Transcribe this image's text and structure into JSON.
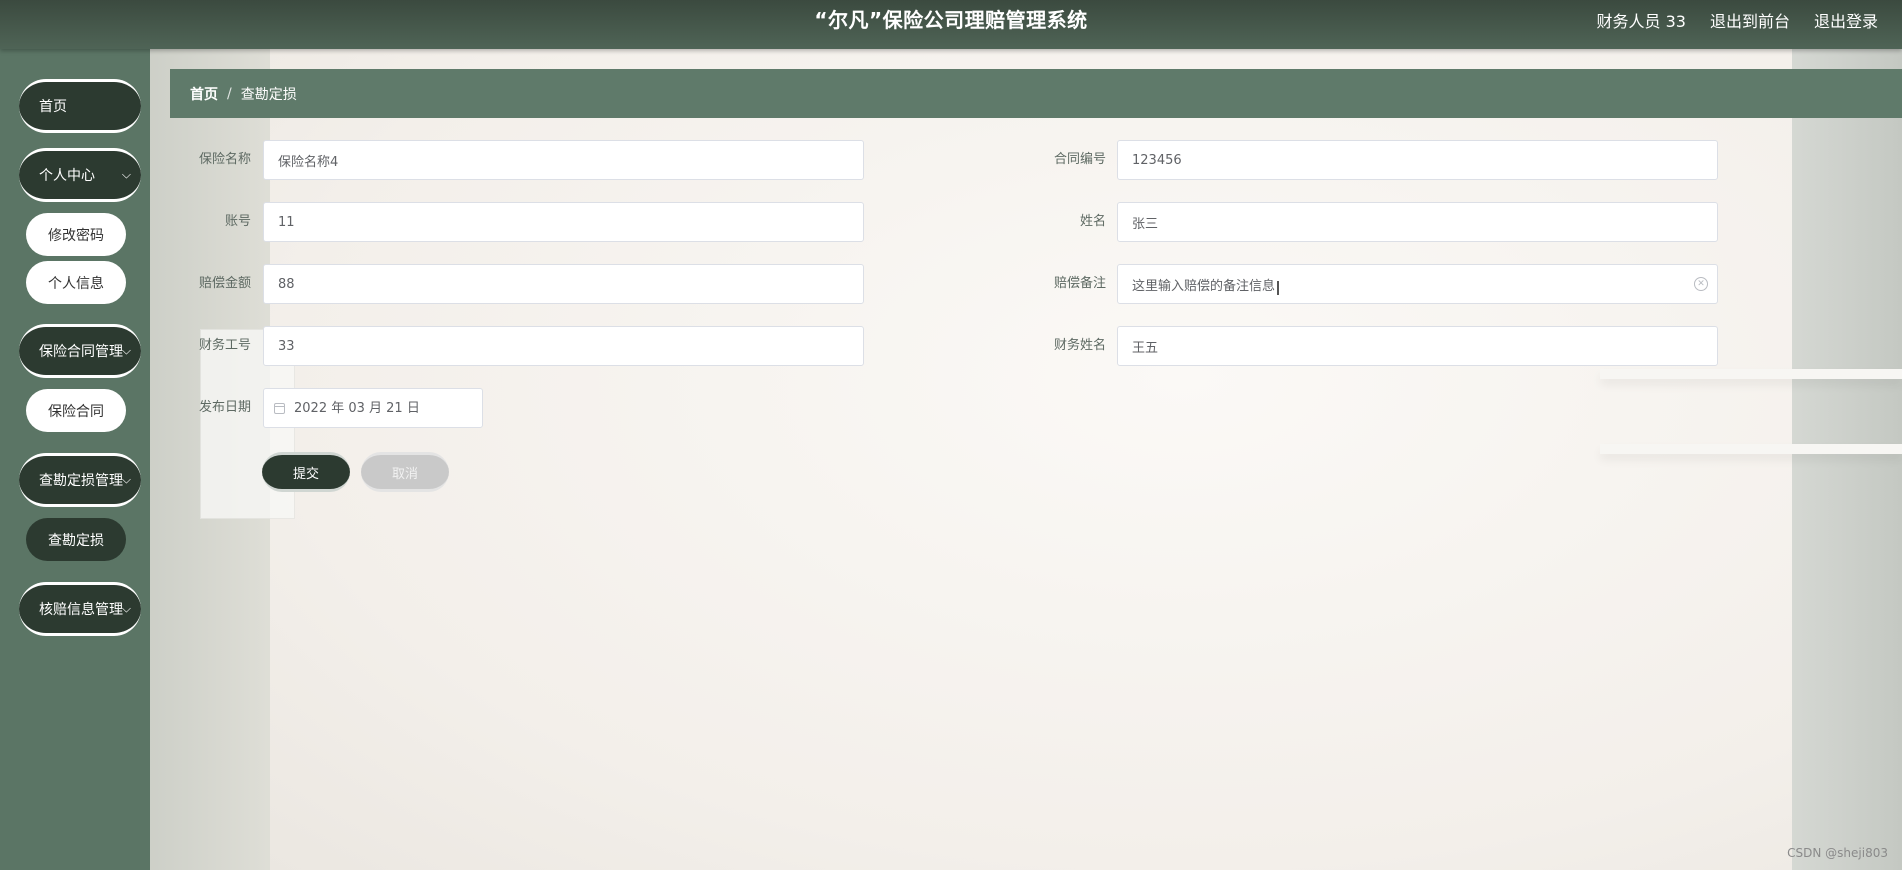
{
  "header": {
    "title": "“尔凡”保险公司理赔管理系统",
    "user": "财务人员 33",
    "to_front": "退出到前台",
    "logout": "退出登录"
  },
  "sidebar": {
    "home": "首页",
    "personal_center": "个人中心",
    "change_password": "修改密码",
    "personal_info": "个人信息",
    "contract_mgmt": "保险合同管理",
    "contract": "保险合同",
    "survey_mgmt": "查勘定损管理",
    "survey": "查勘定损",
    "claim_review_mgmt": "核赔信息管理"
  },
  "breadcrumb": {
    "home": "首页",
    "separator": "/",
    "current": "查勘定损"
  },
  "form": {
    "insurance_name": {
      "label": "保险名称",
      "value": "保险名称4"
    },
    "contract_no": {
      "label": "合同编号",
      "value": "123456"
    },
    "account": {
      "label": "账号",
      "value": "11"
    },
    "name": {
      "label": "姓名",
      "value": "张三"
    },
    "claim_amount": {
      "label": "赔偿金额",
      "value": "88"
    },
    "claim_remark": {
      "label": "赔偿备注",
      "value": "这里输入赔偿的备注信息"
    },
    "finance_id": {
      "label": "财务工号",
      "value": "33"
    },
    "finance_name": {
      "label": "财务姓名",
      "value": "王五"
    },
    "publish_date": {
      "label": "发布日期",
      "value": "2022 年 03 月 21 日"
    },
    "submit": "提交",
    "cancel": "取消"
  },
  "watermark": "CSDN @sheji803",
  "colors": {
    "header": "#3b4a3f",
    "sidebar": "#5b7565",
    "breadcrumb": "#5f7a6a",
    "active": "#2c3a30"
  }
}
